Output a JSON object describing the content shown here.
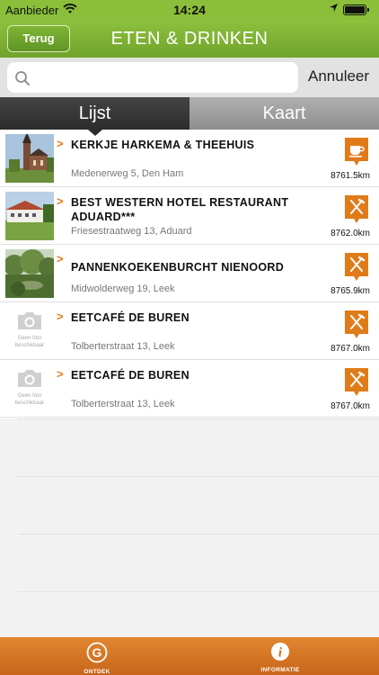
{
  "status": {
    "carrier": "Aanbieder",
    "time": "14:24"
  },
  "nav": {
    "back_label": "Terug",
    "title": "ETEN & DRINKEN"
  },
  "search": {
    "placeholder": "",
    "value": "",
    "cancel_label": "Annuleer"
  },
  "segments": {
    "list_label": "Lijst",
    "map_label": "Kaart",
    "selected": "Lijst"
  },
  "colors": {
    "green": "#7cb536",
    "orange": "#e07b1a"
  },
  "items": [
    {
      "name": "KERKJE HARKEMA & THEEHUIS",
      "address": "Medenerweg 5, Den Ham",
      "distance": "8761.5km",
      "category_icon": "coffee-cup-icon",
      "photo": "church"
    },
    {
      "name": "BEST WESTERN HOTEL RESTAURANT ADUARD***",
      "address": "Friesestraatweg 13, Aduard",
      "distance": "8762.0km",
      "category_icon": "fork-knife-icon",
      "photo": "hotel"
    },
    {
      "name": "PANNENKOEKENBURCHT NIENOORD",
      "address": "Midwolderweg 19, Leek",
      "distance": "8765.9km",
      "category_icon": "fork-knife-icon",
      "photo": "park"
    },
    {
      "name": "EETCAFÉ DE BUREN",
      "address": "Tolberterstraat 13, Leek",
      "distance": "8767.0km",
      "category_icon": "fork-knife-icon",
      "photo": "none"
    },
    {
      "name": "EETCAFÉ DE BUREN",
      "address": "Tolberterstraat 13, Leek",
      "distance": "8767.0km",
      "category_icon": "fork-knife-icon",
      "photo": "none"
    }
  ],
  "no_photo_text": "Geen foto beschikbaar",
  "tabbar": {
    "tab1_label": "ONTDEK",
    "tab2_label": "INFORMATIE"
  }
}
